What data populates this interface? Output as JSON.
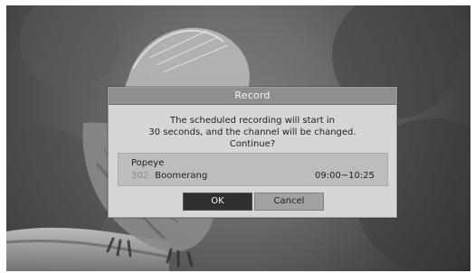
{
  "dialog": {
    "title": "Record",
    "message_lines": [
      "The scheduled recording will start in",
      "30 seconds, and the channel will be changed.",
      "Continue?"
    ],
    "program": {
      "title": "Popeye",
      "channel_number": "302",
      "channel_name": "Boomerang",
      "time_range": "09:00~10:25"
    },
    "buttons": {
      "ok": "OK",
      "cancel": "Cancel"
    }
  }
}
